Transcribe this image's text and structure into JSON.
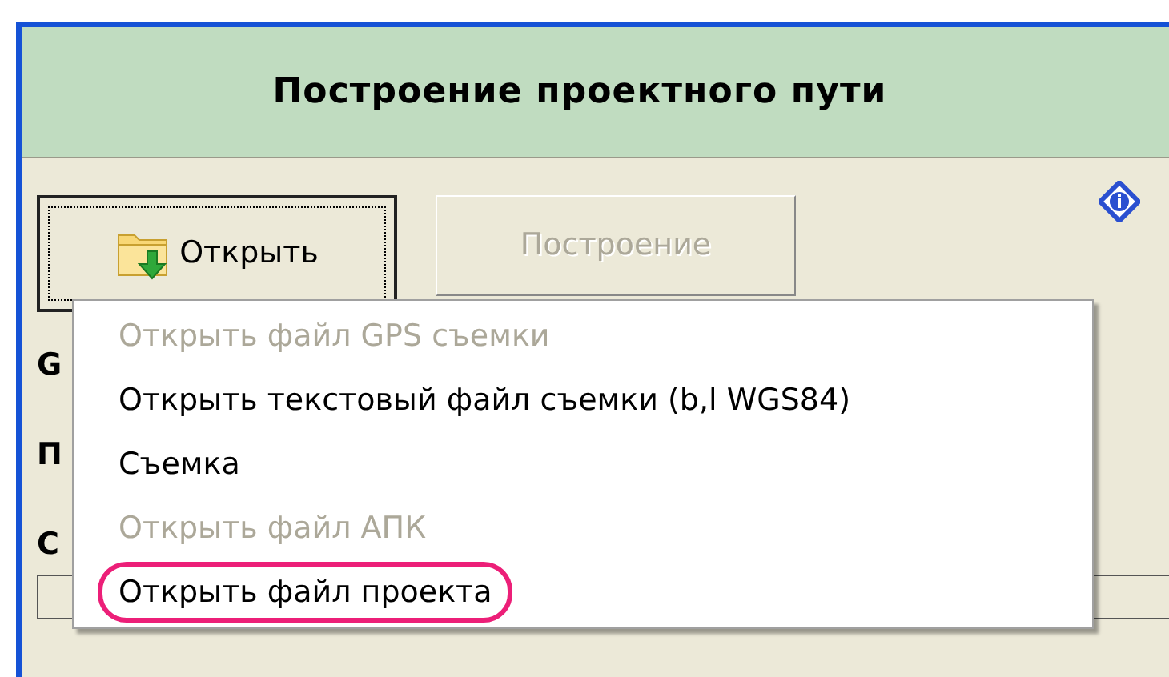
{
  "window": {
    "title": "Построение проектного пути"
  },
  "toolbar": {
    "buttons": [
      {
        "label": "Открыть",
        "disabled": false,
        "focused": true,
        "kind": "icon"
      },
      {
        "label": "Построение",
        "disabled": true,
        "focused": false,
        "kind": "plain"
      }
    ]
  },
  "labels": [
    "G",
    "П",
    "С"
  ],
  "menu": {
    "items": [
      {
        "label": "Открыть файл GPS съемки",
        "disabled": true,
        "highlighted": false
      },
      {
        "label": "Открыть текстовый файл съемки (b,l WGS84)",
        "disabled": false,
        "highlighted": false
      },
      {
        "label": "Съемка",
        "disabled": false,
        "highlighted": false
      },
      {
        "label": "Открыть файл АПК",
        "disabled": true,
        "highlighted": false
      },
      {
        "label": "Открыть файл проекта",
        "disabled": false,
        "highlighted": true
      }
    ]
  }
}
